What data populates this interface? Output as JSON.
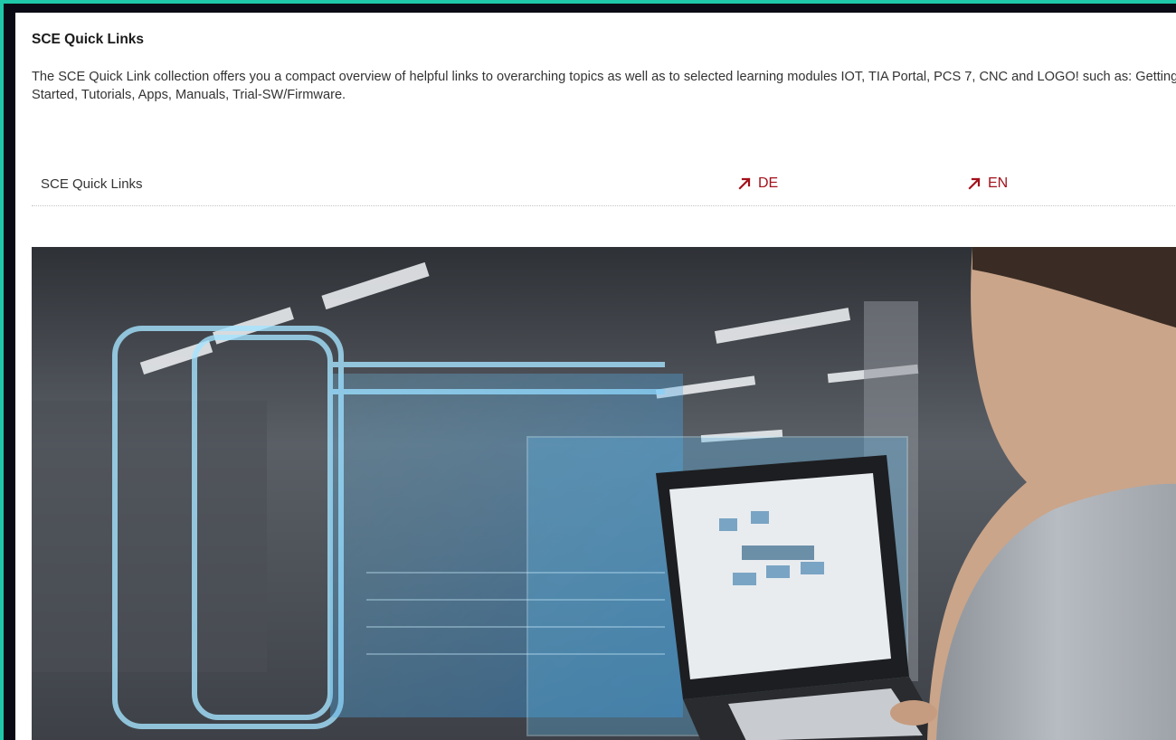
{
  "section": {
    "title": "SCE Quick Links",
    "intro": "The SCE Quick Link collection offers you a compact overview of helpful links to overarching topics as well as to selected learning modules IOT, TIA Portal, PCS 7, CNC and LOGO! such as: Getting Started, Tutorials, Apps, Manuals, Trial-SW/Firmware."
  },
  "quick_links_row": {
    "label": "SCE Quick Links",
    "links": [
      {
        "label": "DE",
        "icon": "external-arrow-icon"
      },
      {
        "label": "EN",
        "icon": "external-arrow-icon"
      }
    ]
  },
  "colors": {
    "accent_frame": "#1fc8a8",
    "link_red": "#a3111b"
  }
}
